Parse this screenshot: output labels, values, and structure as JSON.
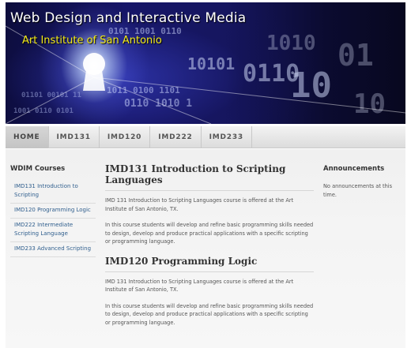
{
  "banner": {
    "title": "Web Design and Interactive Media",
    "subtitle": "Art Institute of San Antonio",
    "image_icon": "keyhole-binary-tunnel-graphic",
    "colors": {
      "title": "#ffffff",
      "subtitle": "#f2ea19",
      "background": "#161660"
    }
  },
  "nav": {
    "items": [
      {
        "label": "HOME",
        "active": true
      },
      {
        "label": "IMD131"
      },
      {
        "label": "IMD120"
      },
      {
        "label": "IMD222"
      },
      {
        "label": "IMD233"
      }
    ]
  },
  "sidebar": {
    "heading": "WDIM Courses",
    "items": [
      {
        "label": "IMD131 Introduction to Scripting"
      },
      {
        "label": "IMD120 Programming Logic"
      },
      {
        "label": "IMD222 Intermediate Scripting Language"
      },
      {
        "label": "IMD233 Advanced Scripting"
      }
    ]
  },
  "main": {
    "articles": [
      {
        "title": "IMD131 Introduction to Scripting Languages",
        "paragraphs": [
          "IMD 131 Introduction to Scripting Languages course is offered at the Art Institute of San Antonio, TX.",
          "In this course students will develop and refine basic programming skills needed to design, develop and produce practical applications with a specific scripting or programming language."
        ]
      },
      {
        "title": "IMD120 Programming Logic",
        "paragraphs": [
          "IMD 131 Introduction to Scripting Languages course is offered at the Art Institute of San Antonio, TX.",
          "In this course students will develop and refine basic programming skills needed to design, develop and produce practical applications with a specific scripting or programming language."
        ]
      }
    ]
  },
  "announcements": {
    "heading": "Announcements",
    "text": "No announcements at this time."
  }
}
